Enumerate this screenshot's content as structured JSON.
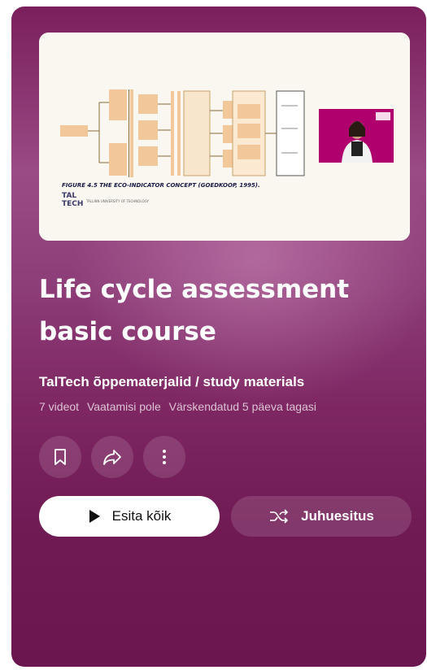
{
  "playlist": {
    "title": "Life cycle assessment basic course",
    "channel": "TalTech õppematerjalid / study materials",
    "meta": {
      "video_count": "7 videot",
      "views": "Vaatamisi pole",
      "updated": "Värskendatud 5 päeva tagasi"
    }
  },
  "thumbnail": {
    "figure_caption": "FIGURE 4.5 THE ECO-INDICATOR CONCEPT (GOEDKOOP, 1995).",
    "logo_text": "TAL TECH",
    "university_line": "TALLINN UNIVERSITY OF TECHNOLOGY"
  },
  "actions": {
    "icons": [
      "bookmark-icon",
      "share-icon",
      "more-vert-icon"
    ],
    "play_all_label": "Esita kõik",
    "shuffle_label": "Juhuesitus"
  },
  "colors": {
    "card_top": "#7a1f5c",
    "card_bottom": "#6c1650",
    "thumb_bg": "#f9f7ef",
    "diagram_box": "#f2c89a",
    "speaker_bg": "#b0006e"
  }
}
